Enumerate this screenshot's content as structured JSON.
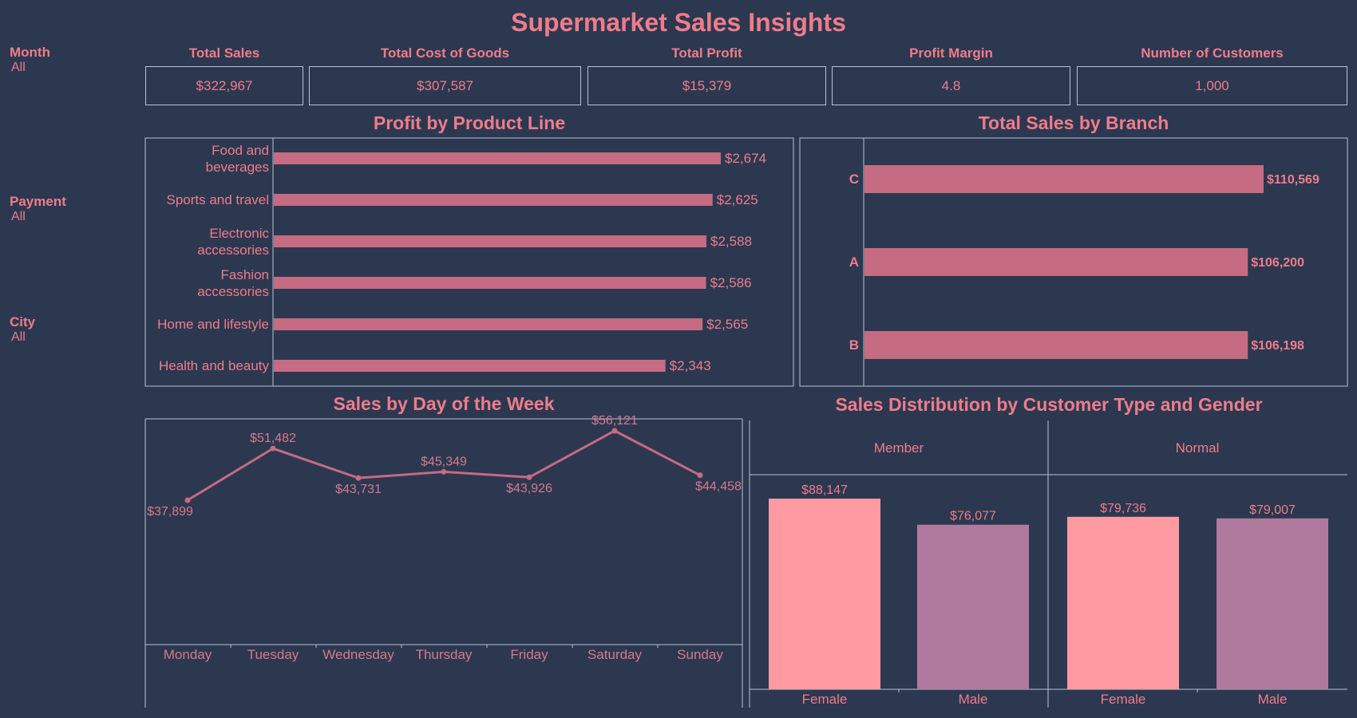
{
  "title": "Supermarket Sales Insights",
  "filters": [
    {
      "label": "Month",
      "value": "All"
    },
    {
      "label": "Payment",
      "value": "All"
    },
    {
      "label": "City",
      "value": "All"
    }
  ],
  "kpis": [
    {
      "label": "Total Sales",
      "value": "$322,967"
    },
    {
      "label": "Total Cost of Goods",
      "value": "$307,587"
    },
    {
      "label": "Total Profit",
      "value": "$15,379"
    },
    {
      "label": "Profit Margin",
      "value": "4.8"
    },
    {
      "label": "Number of Customers",
      "value": "1,000"
    }
  ],
  "colors": {
    "background": "#2b3850",
    "text": "#f07c8a",
    "bar": "#c56b82",
    "female": "#ff9aa2",
    "male": "#b07a9e",
    "axis": "#b8c2d2"
  },
  "chart_data": [
    {
      "id": "profit_by_product_line",
      "type": "bar",
      "orientation": "horizontal",
      "title": "Profit by Product Line",
      "categories": [
        [
          "Food and",
          "beverages"
        ],
        [
          "Sports and travel"
        ],
        [
          "Electronic",
          "accessories"
        ],
        [
          "Fashion",
          "accessories"
        ],
        [
          "Home and lifestyle"
        ],
        [
          "Health and beauty"
        ]
      ],
      "values": [
        2674,
        2625,
        2588,
        2586,
        2565,
        2343
      ],
      "labels": [
        "$2,674",
        "$2,625",
        "$2,588",
        "$2,586",
        "$2,565",
        "$2,343"
      ]
    },
    {
      "id": "total_sales_by_branch",
      "type": "bar",
      "orientation": "horizontal",
      "title": "Total Sales by Branch",
      "categories": [
        "C",
        "A",
        "B"
      ],
      "values": [
        110569,
        106200,
        106198
      ],
      "labels": [
        "$110,569",
        "$106,200",
        "$106,198"
      ]
    },
    {
      "id": "sales_by_day",
      "type": "line",
      "title": "Sales by Day of the Week",
      "categories": [
        "Monday",
        "Tuesday",
        "Wednesday",
        "Thursday",
        "Friday",
        "Saturday",
        "Sunday"
      ],
      "values": [
        37899,
        51482,
        43731,
        45349,
        43926,
        56121,
        44458
      ],
      "labels": [
        "$37,899",
        "$51,482",
        "$43,731",
        "$45,349",
        "$43,926",
        "$56,121",
        "$44,458"
      ]
    },
    {
      "id": "sales_by_customer_type_gender",
      "type": "bar",
      "title": "Sales Distribution by Customer Type and Gender",
      "groups": [
        {
          "name": "Member",
          "categories": [
            "Female",
            "Male"
          ],
          "values": [
            88147,
            76077
          ],
          "labels": [
            "$88,147",
            "$76,077"
          ]
        },
        {
          "name": "Normal",
          "categories": [
            "Female",
            "Male"
          ],
          "values": [
            79736,
            79007
          ],
          "labels": [
            "$79,736",
            "$79,007"
          ]
        }
      ]
    }
  ]
}
